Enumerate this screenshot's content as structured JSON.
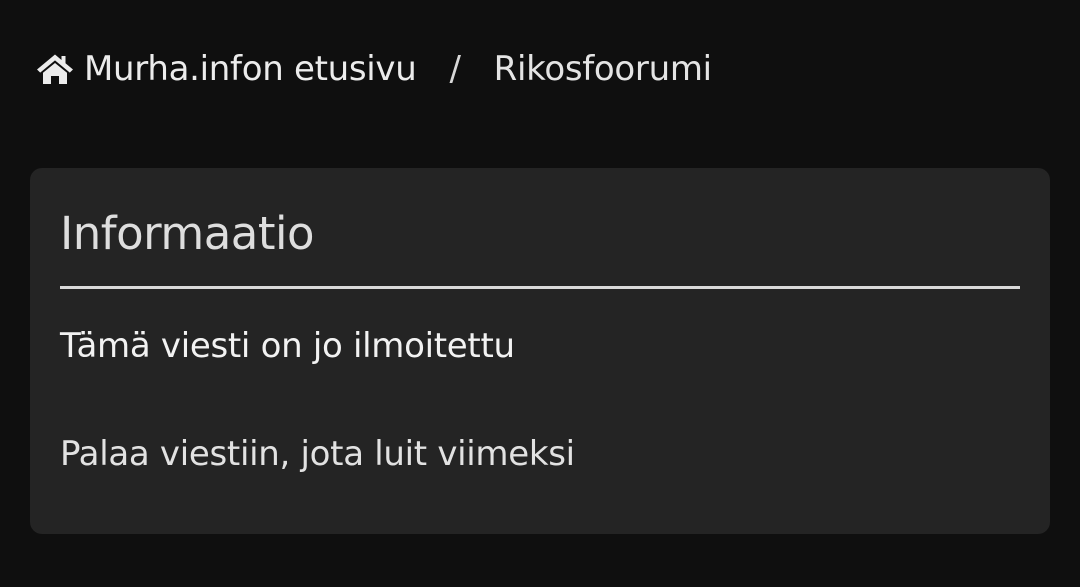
{
  "breadcrumb": {
    "home_icon": "home-icon",
    "home_label": "Murha.infon etusivu",
    "separator": "/",
    "current_label": "Rikosfoorumi"
  },
  "info_box": {
    "title": "Informaatio",
    "message": "Tämä viesti on jo ilmoitettu",
    "return_link": "Palaa viestiin, jota luit viimeksi"
  },
  "colors": {
    "page_background": "#0f0f0f",
    "card_background": "#242424",
    "divider": "#d9d9d9",
    "text": "#e4e4e4"
  }
}
